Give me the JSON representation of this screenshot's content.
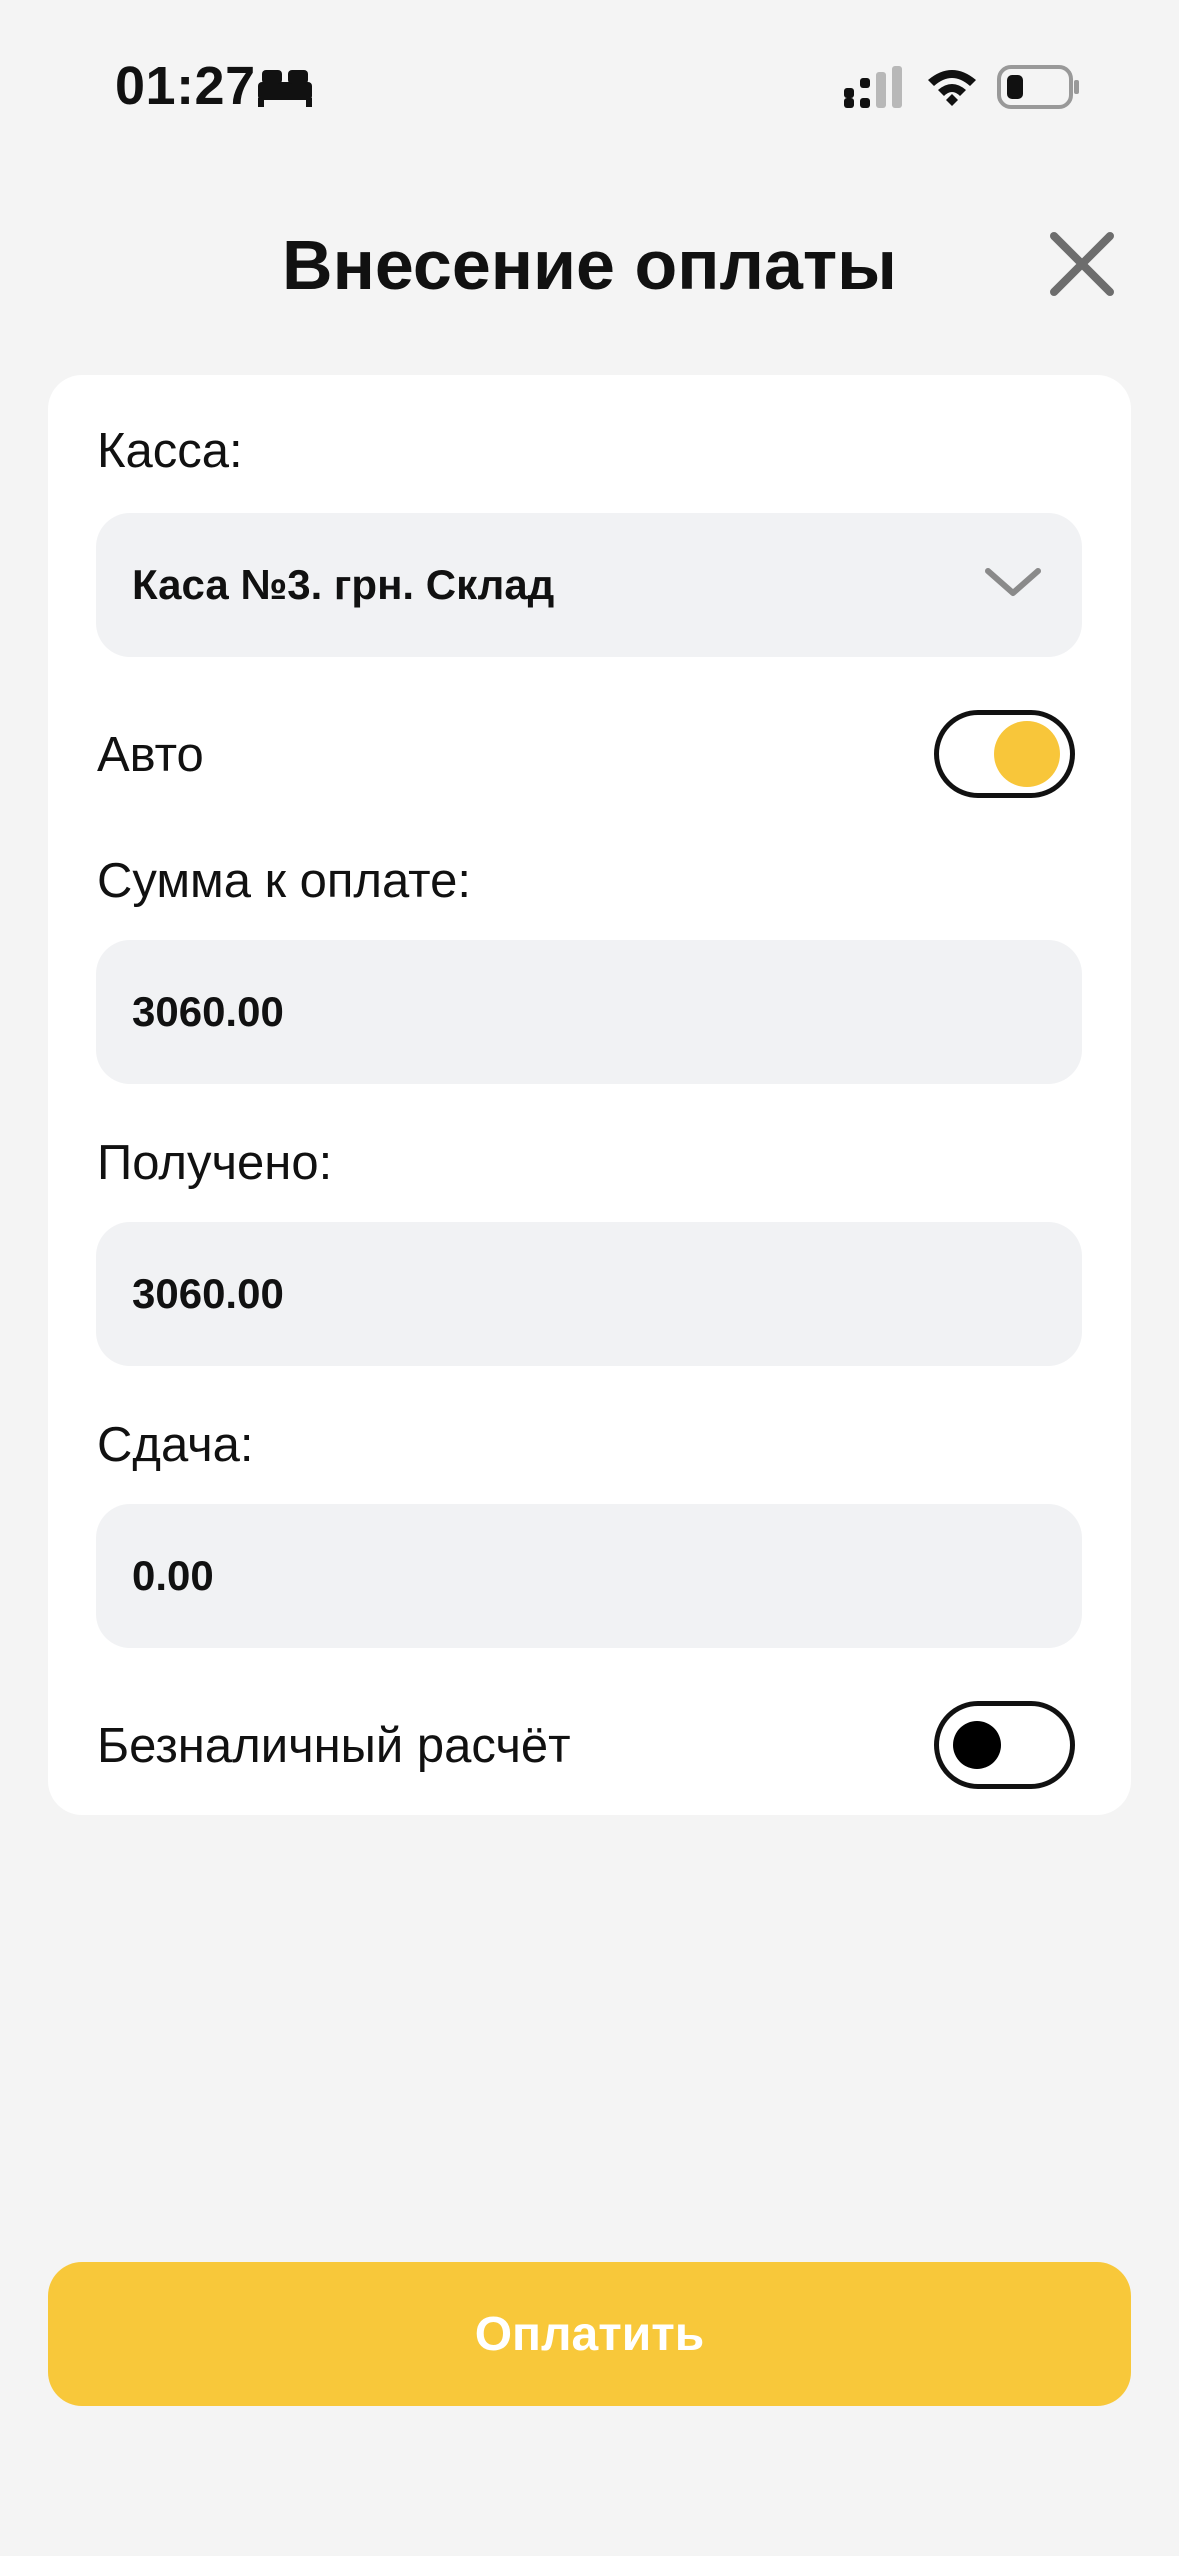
{
  "status_bar": {
    "time": "01:27"
  },
  "header": {
    "title": "Внесение оплаты"
  },
  "form": {
    "register": {
      "label": "Касса:",
      "value": "Каса №3. грн. Склад"
    },
    "auto": {
      "label": "Авто",
      "enabled": true
    },
    "amount_due": {
      "label": "Сумма к оплате:",
      "value": "3060.00"
    },
    "received": {
      "label": "Получено:",
      "value": "3060.00"
    },
    "change": {
      "label": "Сдача:",
      "value": "0.00"
    },
    "cashless": {
      "label": "Безналичный расчёт",
      "enabled": false
    }
  },
  "actions": {
    "pay_label": "Оплатить"
  },
  "colors": {
    "accent": "#f8c83a",
    "background": "#f4f4f4",
    "card": "#ffffff",
    "field": "#f1f2f4"
  }
}
